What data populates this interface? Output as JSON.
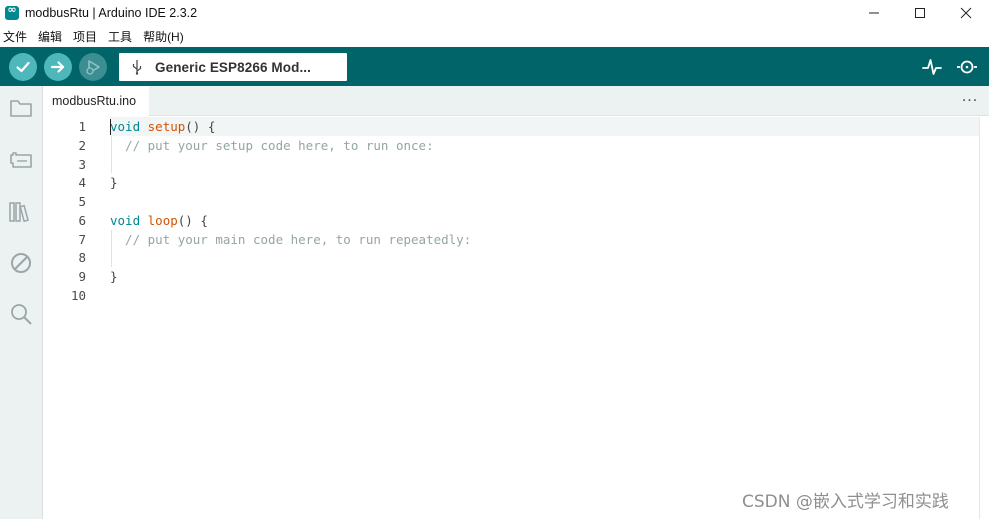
{
  "window": {
    "title": "modbusRtu | Arduino IDE 2.3.2",
    "controls": [
      "minimize-icon",
      "maximize-icon",
      "close-icon"
    ]
  },
  "menu": {
    "items": [
      "文件",
      "编辑",
      "项目",
      "工具",
      "帮助(H)"
    ]
  },
  "toolbar": {
    "verify_icon": "check-icon",
    "upload_icon": "arrow-right-icon",
    "debug_icon": "debug-icon",
    "board_label": "Generic ESP8266 Mod...",
    "board_icon": "usb-icon",
    "serial_plotter_icon": "plotter-icon",
    "serial_monitor_icon": "monitor-icon"
  },
  "sidebar": {
    "items": [
      "folder-icon",
      "board-icon",
      "library-icon",
      "debug-off-icon",
      "search-icon"
    ]
  },
  "tabs": {
    "items": [
      {
        "label": "modbusRtu.ino"
      }
    ],
    "more_label": "···"
  },
  "editor": {
    "line_numbers": [
      "1",
      "2",
      "3",
      "4",
      "5",
      "6",
      "7",
      "8",
      "9",
      "10"
    ],
    "lines": {
      "l1_kw": "void",
      "l1_fn": "setup",
      "l1_rest": "() {",
      "l2_comment": "  // put your setup code here, to run once:",
      "l4": "}",
      "l6_kw": "void",
      "l6_fn": "loop",
      "l6_rest": "() {",
      "l7_comment": "  // put your main code here, to run repeatedly:",
      "l9": "}"
    }
  },
  "watermark": "CSDN @嵌入式学习和实践",
  "colors": {
    "toolbar": "#006468",
    "button_active": "#4db7bb",
    "keyword": "#00878f",
    "function": "#d35400",
    "comment": "#95a5a6"
  }
}
